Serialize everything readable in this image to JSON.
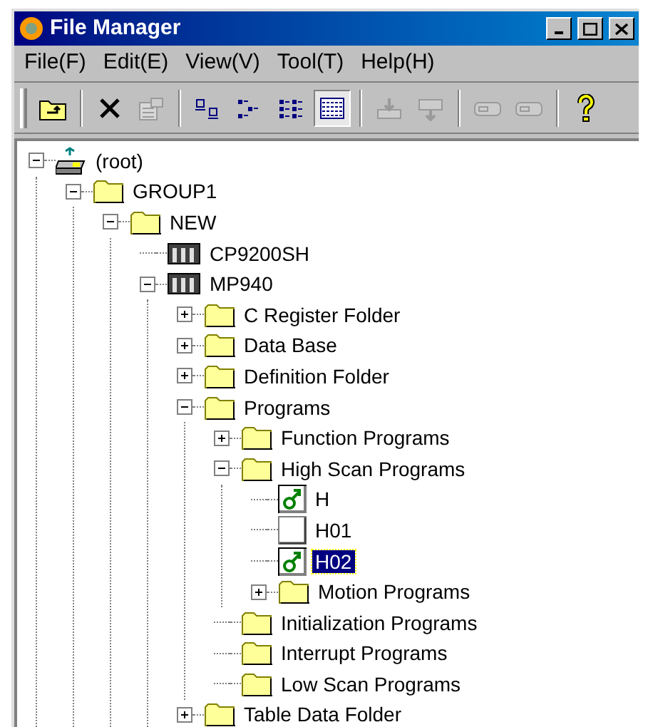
{
  "window": {
    "title": "File Manager"
  },
  "menu": [
    "File(F)",
    "Edit(E)",
    "View(V)",
    "Tool(T)",
    "Help(H)"
  ],
  "toolbar": [
    {
      "kind": "folder-up",
      "disabled": false,
      "pressed": false
    },
    {
      "kind": "sep"
    },
    {
      "kind": "delete",
      "disabled": false,
      "pressed": false
    },
    {
      "kind": "properties",
      "disabled": true,
      "pressed": false
    },
    {
      "kind": "sep"
    },
    {
      "kind": "large-icons",
      "disabled": false,
      "pressed": false
    },
    {
      "kind": "small-icons",
      "disabled": false,
      "pressed": false
    },
    {
      "kind": "list",
      "disabled": false,
      "pressed": false
    },
    {
      "kind": "details",
      "disabled": false,
      "pressed": true
    },
    {
      "kind": "sep"
    },
    {
      "kind": "download",
      "disabled": true,
      "pressed": false
    },
    {
      "kind": "upload",
      "disabled": true,
      "pressed": false
    },
    {
      "kind": "sep"
    },
    {
      "kind": "cassette",
      "disabled": true,
      "pressed": false
    },
    {
      "kind": "cassette",
      "disabled": true,
      "pressed": false
    },
    {
      "kind": "sep"
    },
    {
      "kind": "help",
      "disabled": false,
      "pressed": false
    }
  ],
  "tree": [
    {
      "label": "(root)",
      "kind": "drive",
      "expanded": true,
      "selected": false,
      "children": [
        {
          "label": "GROUP1",
          "kind": "folder",
          "expanded": true,
          "selected": false,
          "children": [
            {
              "label": "NEW",
              "kind": "folder",
              "expanded": true,
              "selected": false,
              "children": [
                {
                  "label": "CP9200SH",
                  "kind": "controller",
                  "selected": false
                },
                {
                  "label": "MP940",
                  "kind": "controller",
                  "expanded": true,
                  "selected": false,
                  "children": [
                    {
                      "label": "C Register Folder",
                      "kind": "folder",
                      "expanded": false,
                      "selected": false
                    },
                    {
                      "label": "Data Base",
                      "kind": "folder",
                      "expanded": false,
                      "selected": false
                    },
                    {
                      "label": "Definition Folder",
                      "kind": "folder",
                      "expanded": false,
                      "selected": false
                    },
                    {
                      "label": "Programs",
                      "kind": "folder",
                      "expanded": true,
                      "selected": false,
                      "children": [
                        {
                          "label": "Function Programs",
                          "kind": "folder",
                          "expanded": false,
                          "selected": false
                        },
                        {
                          "label": "High Scan Programs",
                          "kind": "folder",
                          "expanded": true,
                          "selected": false,
                          "children": [
                            {
                              "label": "H",
                              "kind": "program",
                              "selected": false
                            },
                            {
                              "label": "H01",
                              "kind": "blank",
                              "selected": false
                            },
                            {
                              "label": "H02",
                              "kind": "program",
                              "selected": true
                            },
                            {
                              "label": "Motion Programs",
                              "kind": "folder",
                              "expanded": false,
                              "selected": false
                            }
                          ]
                        },
                        {
                          "label": "Initialization Programs",
                          "kind": "folder",
                          "selected": false
                        },
                        {
                          "label": "Interrupt Programs",
                          "kind": "folder",
                          "selected": false
                        },
                        {
                          "label": "Low Scan Programs",
                          "kind": "folder",
                          "selected": false
                        }
                      ]
                    },
                    {
                      "label": "Table Data Folder",
                      "kind": "folder",
                      "expanded": false,
                      "selected": false
                    }
                  ]
                }
              ]
            }
          ]
        }
      ]
    }
  ]
}
